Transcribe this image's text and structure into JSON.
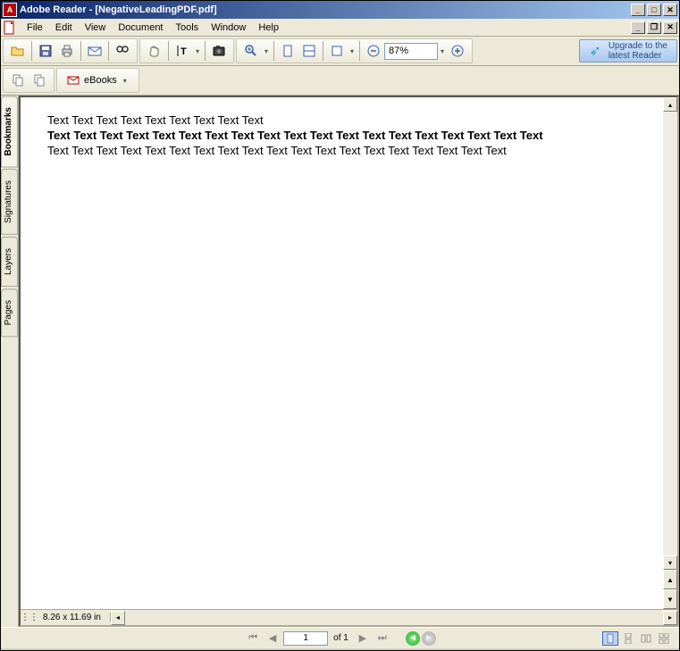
{
  "titlebar": {
    "app": "Adobe Reader",
    "doc": "[NegativeLeadingPDF.pdf]",
    "full": "Adobe Reader - [NegativeLeadingPDF.pdf]"
  },
  "menu": {
    "file": "File",
    "edit": "Edit",
    "view": "View",
    "document": "Document",
    "tools": "Tools",
    "window": "Window",
    "help": "Help"
  },
  "toolbar": {
    "zoom_value": "87%",
    "upgrade_line1": "Upgrade to the",
    "upgrade_line2": "latest Reader",
    "ebooks_label": "eBooks"
  },
  "side_tabs": {
    "bookmarks": "Bookmarks",
    "signatures": "Signatures",
    "layers": "Layers",
    "pages": "Pages"
  },
  "document": {
    "line1": "Text Text Text Text Text Text Text Text Text",
    "line2": "Text Text Text Text Text Text Text Text Text Text Text Text Text Text Text Text Text Text Text",
    "line3": "Text Text Text Text Text Text Text Text Text Text Text Text Text Text Text Text Text Text Text"
  },
  "status": {
    "dimensions": "8.26 x 11.69 in"
  },
  "nav": {
    "page_current": "1",
    "page_of": "of 1"
  }
}
